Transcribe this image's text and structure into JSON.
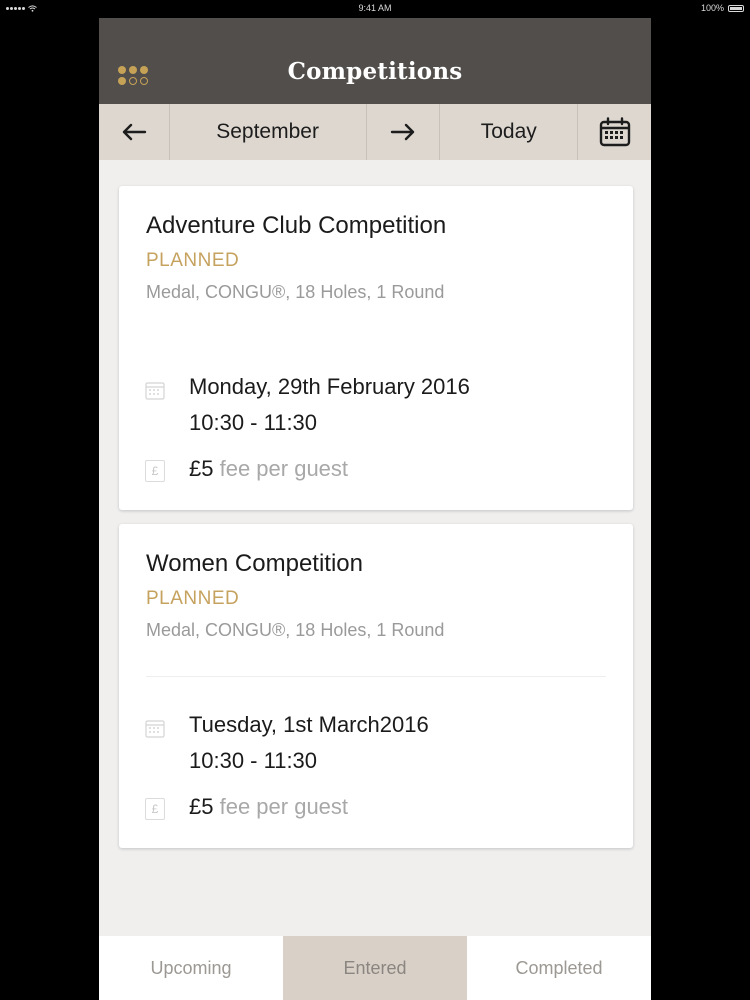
{
  "status_bar": {
    "time": "9:41 AM",
    "battery": "100%"
  },
  "header": {
    "title": "Competitions",
    "menu_icon": "grid-menu-icon"
  },
  "nav": {
    "prev_icon": "left-arrow-icon",
    "month": "September",
    "next_icon": "right-arrow-icon",
    "today": "Today",
    "calendar_icon": "calendar-icon"
  },
  "competitions": [
    {
      "title": "Adventure Club Competition",
      "status": "PLANNED",
      "format": "Medal, CONGU®, 18 Holes, 1 Round",
      "date": "Monday, 29th February 2016",
      "time": "10:30 - 11:30",
      "fee_amount": "£5",
      "fee_label": "fee per guest"
    },
    {
      "title": "Women Competition",
      "status": "PLANNED",
      "format": "Medal, CONGU®, 18 Holes, 1 Round",
      "date": "Tuesday, 1st March2016",
      "time": "10:30 - 11:30",
      "fee_amount": "£5",
      "fee_label": "fee per guest"
    }
  ],
  "tabs": [
    {
      "label": "Upcoming",
      "active": false
    },
    {
      "label": "Entered",
      "active": true
    },
    {
      "label": "Completed",
      "active": false
    }
  ],
  "colors": {
    "header_bg": "#514e4b",
    "nav_bg": "#ddd7d0",
    "accent_gold": "#c6a25f",
    "active_tab_bg": "#d9d1c8",
    "page_bg": "#f0efee"
  }
}
